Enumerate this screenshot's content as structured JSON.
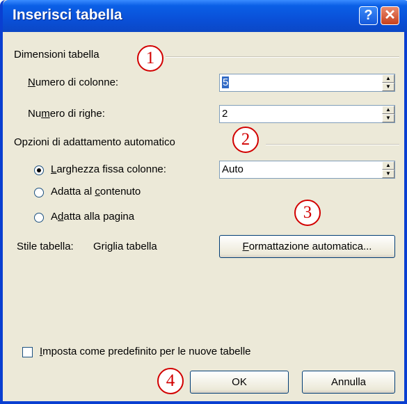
{
  "window": {
    "title": "Inserisci tabella",
    "help_icon": "?",
    "close_icon": "✕"
  },
  "dimensions": {
    "group_label": "Dimensioni tabella",
    "cols_label_u": "N",
    "cols_label_rest": "umero di colonne:",
    "cols_value": "5",
    "rows_label_pre": "Nu",
    "rows_label_u": "m",
    "rows_label_rest": "ero di righe:",
    "rows_value": "2"
  },
  "autofit": {
    "group_label": "Opzioni di adattamento automatico",
    "fixed_u": "L",
    "fixed_rest": "arghezza fissa colonne:",
    "fixed_value": "Auto",
    "content_pre": "Adatta al ",
    "content_u": "c",
    "content_rest": "ontenuto",
    "window_pre": "A",
    "window_u": "d",
    "window_rest": "atta alla pagina",
    "selected": "fixed"
  },
  "style": {
    "label": "Stile tabella:",
    "value": "Griglia tabella",
    "autoformat_u": "F",
    "autoformat_rest": "ormattazione automatica..."
  },
  "default": {
    "checked": false,
    "u": "I",
    "rest": "mposta come predefinito per le nuove tabelle"
  },
  "buttons": {
    "ok": "OK",
    "cancel": "Annulla"
  },
  "callouts": [
    "1",
    "2",
    "3",
    "4"
  ]
}
